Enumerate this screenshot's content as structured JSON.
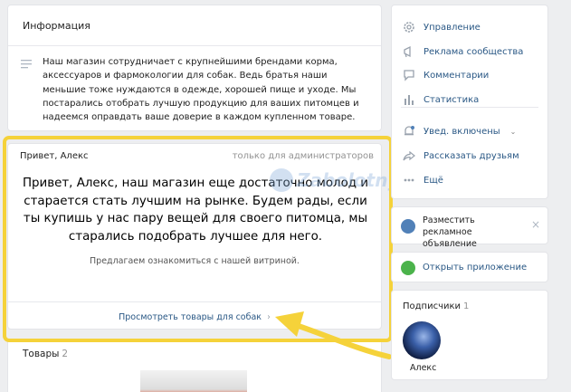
{
  "info": {
    "title": "Информация",
    "description": "Наш магазин сотрудничает с крупнейшими брендами корма, аксессуаров и фармокологии для собак. Ведь братья наши меньшие тоже нуждаются в одежде, хорошей пище и уходе. Мы постарались отобрать лучшую продукцию для ваших питомцев и надеемся оправдать ваше доверие в каждом купленном товаре."
  },
  "welcome": {
    "name": "Привет, Алекс",
    "admin_note": "только для администраторов",
    "message": "Привет, Алекс, наш магазин еще достаточно молод и старается стать лучшим на рынке. Будем рады, если ты купишь у нас пару вещей для своего питомца, мы старались подобрать лучшее для него.",
    "subtitle": "Предлагаем ознакомиться с нашей витриной.",
    "link": "Просмотреть товары для собак"
  },
  "goods": {
    "title": "Товары",
    "count": "2"
  },
  "watermark": {
    "text": "Zabolotny.ru"
  },
  "menu": {
    "items": [
      {
        "label": "Управление",
        "icon": "gear-icon"
      },
      {
        "label": "Реклама сообщества",
        "icon": "megaphone-icon"
      },
      {
        "label": "Комментарии",
        "icon": "comment-icon"
      },
      {
        "label": "Статистика",
        "icon": "stats-icon"
      }
    ],
    "notifications": "Увед. включены",
    "share": "Рассказать друзьям",
    "more": "Ещё"
  },
  "promo": {
    "text": "Разместить рекламное объявление"
  },
  "app": {
    "label": "Открыть приложение"
  },
  "subscribers": {
    "title": "Подписчики",
    "count": "1",
    "name": "Алекс"
  },
  "colors": {
    "accent": "#2a5885",
    "highlight": "#f5d23a",
    "green": "#4bb34b",
    "blue": "#5181b8"
  }
}
